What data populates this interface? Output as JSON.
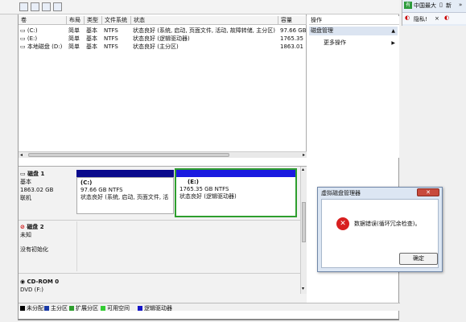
{
  "volume_list": {
    "headers": [
      "卷",
      "布局",
      "类型",
      "文件系统",
      "状态",
      "容量"
    ],
    "rows": [
      {
        "vol": "(C:)",
        "layout": "简单",
        "type": "基本",
        "fs": "NTFS",
        "status": "状态良好 (系统, 启动, 页面文件, 活动, 故障转储, 主分区)",
        "capacity": "97.66 GB"
      },
      {
        "vol": "(E:)",
        "layout": "简单",
        "type": "基本",
        "fs": "NTFS",
        "status": "状态良好 (逻辑驱动器)",
        "capacity": "1765.35"
      },
      {
        "vol": "本地磁盘 (D:)",
        "layout": "简单",
        "type": "基本",
        "fs": "NTFS",
        "status": "状态良好 (主分区)",
        "capacity": "1863.01"
      }
    ]
  },
  "actions": {
    "title": "操作",
    "section": "磁盘管理",
    "more": "更多操作"
  },
  "disks": {
    "disk1": {
      "name": "磁盘 1",
      "type": "基本",
      "size": "1863.02 GB",
      "status": "联机"
    },
    "disk2": {
      "name": "磁盘 2",
      "type": "未知",
      "status": "没有初始化"
    },
    "cdrom": {
      "name": "CD-ROM 0",
      "type": "DVD (F:)"
    }
  },
  "partitions": {
    "c": {
      "name": "(C:)",
      "size": "97.66 GB NTFS",
      "status": "状态良好 (系统, 启动, 页面文件, 活"
    },
    "e": {
      "name": "(E:)",
      "size": "1765.35 GB NTFS",
      "status": "状态良好 (逻辑驱动器)"
    }
  },
  "legend": [
    {
      "label": "未分配",
      "color": "#000000"
    },
    {
      "label": "主分区",
      "color": "#1a3aa6"
    },
    {
      "label": "扩展分区",
      "color": "#2e9e2e"
    },
    {
      "label": "可用空间",
      "color": "#33cc33"
    },
    {
      "label": "逻辑驱动器",
      "color": "#1515c8"
    }
  ],
  "browser": {
    "tab1": "中国最大",
    "tab2": "新",
    "tab3": "隐私!",
    "tab4": "×"
  },
  "dialog": {
    "title": "虚拟磁盘管理器",
    "message": "数据错误(循环冗余检查)。",
    "ok": "确定"
  },
  "colors": {
    "primary_bar": "#0a0a8c",
    "logical_bar": "#1a1ae0",
    "selection": "#2e9e2e",
    "error_icon": "#d81f1f"
  }
}
